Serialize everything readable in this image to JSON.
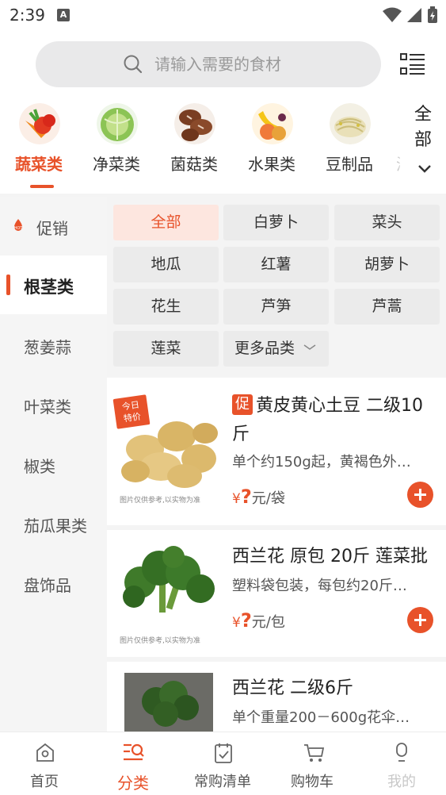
{
  "status_bar": {
    "time": "2:39",
    "notification": "A"
  },
  "search": {
    "placeholder": "请输入需要的食材"
  },
  "categories": [
    {
      "label": "蔬菜类",
      "icon": "vegetables-icon",
      "active": true
    },
    {
      "label": "净菜类",
      "icon": "cabbage-icon",
      "active": false
    },
    {
      "label": "菌菇类",
      "icon": "mushroom-icon",
      "active": false
    },
    {
      "label": "水果类",
      "icon": "fruit-icon",
      "active": false
    },
    {
      "label": "豆制品",
      "icon": "bean-sprout-icon",
      "active": false
    },
    {
      "label": "海",
      "icon": "",
      "active": false
    }
  ],
  "categories_more": {
    "line1": "全",
    "line2": "部"
  },
  "sidebar": {
    "items": [
      {
        "label": "促销",
        "hot": true
      },
      {
        "label": "根茎类",
        "active": true
      },
      {
        "label": "葱姜蒜"
      },
      {
        "label": "叶菜类"
      },
      {
        "label": "椒类"
      },
      {
        "label": "茄瓜果类"
      },
      {
        "label": "盘饰品"
      }
    ]
  },
  "subcategories": {
    "items": [
      "全部",
      "白萝卜",
      "菜头",
      "地瓜",
      "红薯",
      "胡萝卜",
      "花生",
      "芦笋",
      "芦蒿",
      "莲菜"
    ],
    "more": "更多品类"
  },
  "products": [
    {
      "promo_tag": "促",
      "title": "黄皮黄心土豆 二级10斤",
      "desc": "单个约150g起，黄褐色外…",
      "price_symbol": "¥",
      "price": "?",
      "unit": "元/袋",
      "image_note": "图片仅供参考,以实物为准",
      "badge_line1": "今日",
      "badge_line2": "特价"
    },
    {
      "title": "西兰花 原包 20斤 莲菜批",
      "desc": "塑料袋包装，每包约20斤…",
      "price_symbol": "¥",
      "price": "?",
      "unit": "元/包",
      "image_note": "图片仅供参考,以实物为准"
    },
    {
      "title": "西兰花 二级6斤",
      "desc": "单个重量200－600g花伞…"
    }
  ],
  "tabbar": {
    "items": [
      {
        "label": "首页",
        "icon": "home-icon"
      },
      {
        "label": "分类",
        "icon": "category-icon",
        "active": true
      },
      {
        "label": "常购清单",
        "icon": "checklist-icon"
      },
      {
        "label": "购物车",
        "icon": "cart-icon"
      },
      {
        "label": "我的",
        "icon": "user-icon"
      }
    ]
  },
  "colors": {
    "accent": "#e8522a",
    "sidebar_bg": "#f5f5f5",
    "chip_bg": "#ebebeb"
  }
}
